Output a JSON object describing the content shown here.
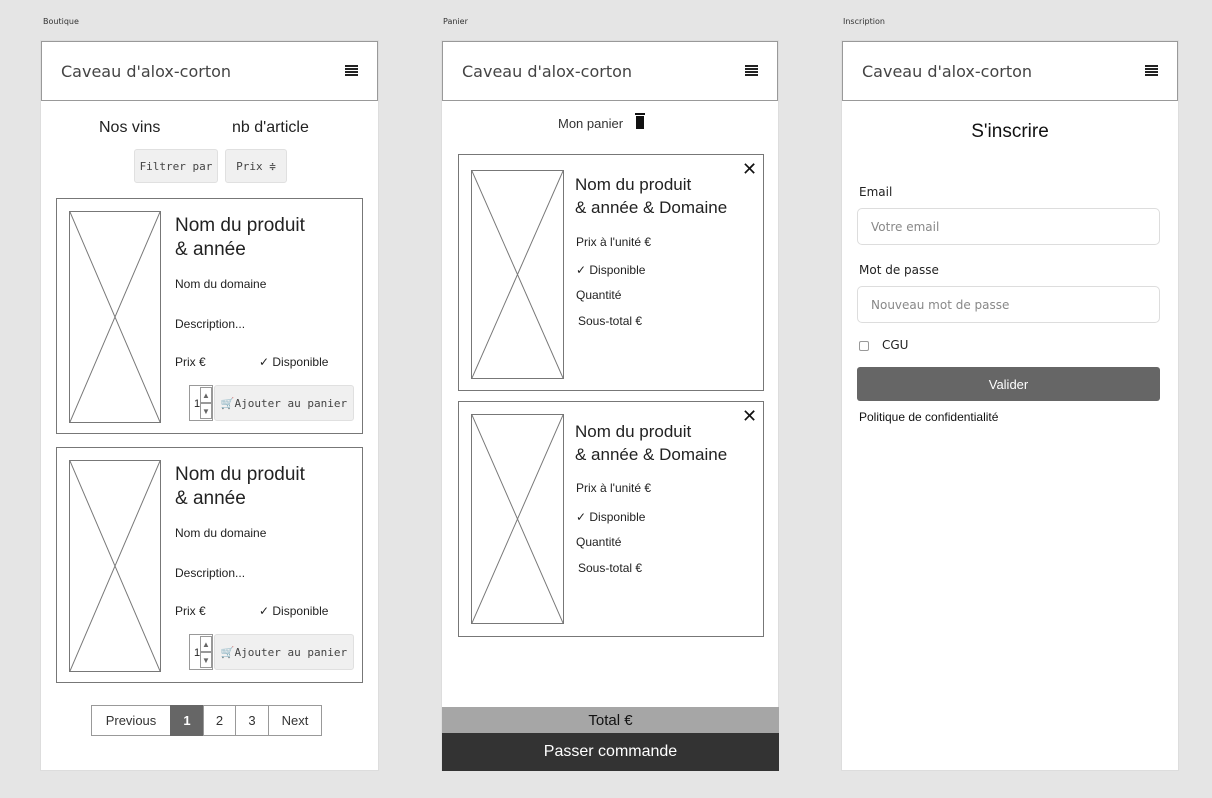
{
  "screens": {
    "boutique": {
      "label": "Boutique"
    },
    "panier": {
      "label": "Panier"
    },
    "inscription": {
      "label": "Inscription"
    }
  },
  "app": {
    "title": "Caveau d'alox-corton"
  },
  "boutique": {
    "heading_left": "Nos vins",
    "heading_right": "nb d'article",
    "filter_label": "Filtrer par",
    "sort_label": "Prix ≑",
    "products": [
      {
        "name_line1": "Nom du produit",
        "name_line2": "& année",
        "domain": "Nom du domaine",
        "description": "Description...",
        "price": "Prix €",
        "availability": "✓ Disponible",
        "quantity": "1",
        "add_label": "Ajouter au panier"
      },
      {
        "name_line1": "Nom du produit",
        "name_line2": "& année",
        "domain": "Nom du domaine",
        "description": "Description...",
        "price": "Prix €",
        "availability": "✓ Disponible",
        "quantity": "1",
        "add_label": "Ajouter au panier"
      }
    ],
    "pagination": {
      "previous": "Previous",
      "pages": [
        "1",
        "2",
        "3"
      ],
      "next": "Next"
    }
  },
  "panier": {
    "title": "Mon panier",
    "items": [
      {
        "name_line1": "Nom du produit",
        "name_line2": "& année & Domaine",
        "unit_price": "Prix à l'unité €",
        "availability": "✓ Disponible",
        "quantity": "Quantité",
        "subtotal": "Sous-total €"
      },
      {
        "name_line1": "Nom du produit",
        "name_line2": "& année & Domaine",
        "unit_price": "Prix à l'unité €",
        "availability": "✓ Disponible",
        "quantity": "Quantité",
        "subtotal": "Sous-total €"
      }
    ],
    "total": "Total €",
    "checkout": "Passer commande"
  },
  "inscription": {
    "title": "S'inscrire",
    "email_label": "Email",
    "email_placeholder": "Votre email",
    "password_label": "Mot de passe",
    "password_placeholder": "Nouveau mot de passe",
    "cgu_label": "CGU",
    "submit": "Valider",
    "privacy": "Politique de confidentialité"
  },
  "colors": {
    "background": "#e5e5e5",
    "dark_button": "#666666",
    "checkout_bar": "#333333",
    "total_bar": "#a6a6a6"
  }
}
